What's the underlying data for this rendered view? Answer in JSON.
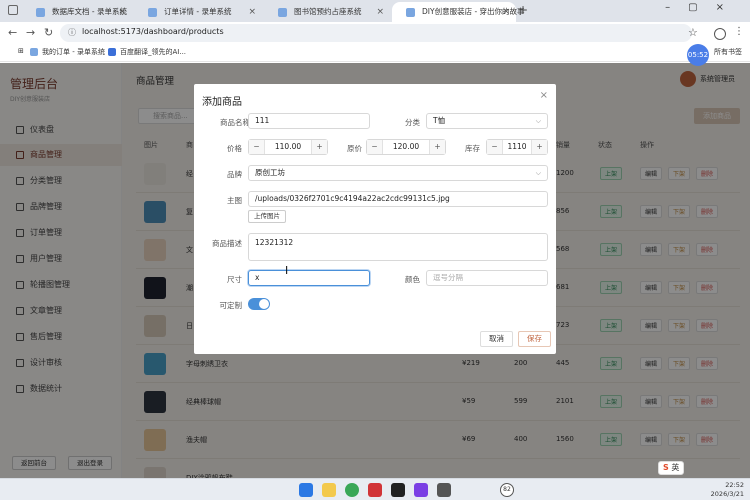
{
  "browser": {
    "tabs": [
      {
        "title": "数据库文档 - 录单系统"
      },
      {
        "title": "订单详情 - 录单系统"
      },
      {
        "title": "图书馆预约占座系统"
      },
      {
        "title": "DIY创意服装店 - 穿出你的故事",
        "active": true
      }
    ],
    "url": "localhost:5173/dashboard/products",
    "bookmarks": [
      "我的订单 - 录单系统",
      "百度翻译_领先的AI..."
    ],
    "all_bookmarks": "所有书签",
    "clock_bubble": "05:52"
  },
  "sidebar": {
    "title": "管理后台",
    "subtitle": "DIY创意服装店",
    "items": [
      {
        "label": "仪表盘"
      },
      {
        "label": "商品管理",
        "active": true
      },
      {
        "label": "分类管理"
      },
      {
        "label": "品牌管理"
      },
      {
        "label": "订单管理"
      },
      {
        "label": "用户管理"
      },
      {
        "label": "轮播图管理"
      },
      {
        "label": "文章管理"
      },
      {
        "label": "售后管理"
      },
      {
        "label": "设计审核"
      },
      {
        "label": "数据统计"
      }
    ],
    "back_button": "返回前台",
    "logout_button": "退出登录"
  },
  "header": {
    "page_title": "商品管理",
    "admin_name": "系统管理员"
  },
  "toolbar": {
    "search_placeholder": "搜索商品...",
    "add_button": "添加商品"
  },
  "table": {
    "headers": {
      "image": "图片",
      "name": "商",
      "sales": "销量",
      "status": "状态",
      "actions": "操作"
    },
    "rows": [
      {
        "name": "经",
        "price": "",
        "stock": "",
        "sales": "1200",
        "status": "上架"
      },
      {
        "name": "复",
        "price": "",
        "stock": "",
        "sales": "856",
        "status": "上架"
      },
      {
        "name": "文",
        "price": "",
        "stock": "",
        "sales": "568",
        "status": "上架"
      },
      {
        "name": "潮",
        "price": "",
        "stock": "",
        "sales": "681",
        "status": "上架"
      },
      {
        "name": "日",
        "price": "",
        "stock": "",
        "sales": "723",
        "status": "上架"
      },
      {
        "name": "字母刺绣卫衣",
        "price": "¥219",
        "stock": "200",
        "sales": "445",
        "status": "上架"
      },
      {
        "name": "经典棒球帽",
        "price": "¥59",
        "stock": "599",
        "sales": "2101",
        "status": "上架"
      },
      {
        "name": "渔夫帽",
        "price": "¥69",
        "stock": "400",
        "sales": "1560",
        "status": "上架"
      },
      {
        "name": "DIY涂鸦帆布鞋",
        "price": "",
        "stock": "",
        "sales": "",
        "status": ""
      }
    ],
    "action_labels": {
      "edit": "编辑",
      "down": "下架",
      "delete": "删除"
    }
  },
  "dialog": {
    "title": "添加商品",
    "close": "×",
    "name_label": "商品名称",
    "name_value": "111",
    "category_label": "分类",
    "category_value": "T恤",
    "price_label": "价格",
    "price_value": "110.00",
    "original_price_label": "原价",
    "original_price_value": "120.00",
    "stock_label": "库存",
    "stock_value": "1110",
    "brand_label": "品牌",
    "brand_value": "原创工坊",
    "image_label": "主图",
    "image_value": "/uploads/0326f2701c9c4194a22ac2cdc99131c5.jpg",
    "upload_button": "上传图片",
    "desc_label": "商品描述",
    "desc_value": "12321312",
    "size_label": "尺寸",
    "size_value": "x",
    "color_label": "颜色",
    "color_placeholder": "逗号分隔",
    "customizable_label": "可定制",
    "customizable": true,
    "cancel_button": "取消",
    "save_button": "保存"
  },
  "taskbar": {
    "time": "22:52",
    "date": "2026/3/21",
    "badge": "82"
  },
  "ime": {
    "mode": "英"
  },
  "colors": {
    "accent": "#7a3b2e",
    "primary_blue": "#4a90d9",
    "status_green": "#2e8b57"
  }
}
